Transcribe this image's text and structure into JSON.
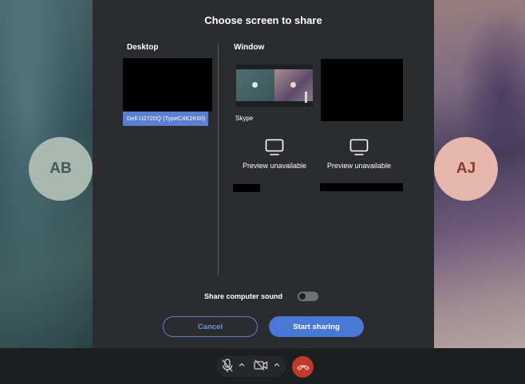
{
  "participants": [
    {
      "initials": "AB",
      "color": "#a9b8b1"
    },
    {
      "initials": "AJ",
      "color": "#e7b6ad"
    }
  ],
  "dialog": {
    "title": "Choose screen to share",
    "desktop": {
      "label": "Desktop",
      "screens": [
        {
          "name": "Dell U2720Q (TypeC4K2K60)",
          "selected": true
        }
      ]
    },
    "window": {
      "label": "Window",
      "items": [
        {
          "name": "Skype"
        },
        {
          "name": ""
        },
        {
          "preview_text": "Preview unavailable"
        },
        {
          "preview_text": "Preview unavailable"
        }
      ]
    },
    "share_sound": {
      "label": "Share computer sound",
      "enabled": false
    },
    "cancel_label": "Cancel",
    "start_label": "Start sharing"
  },
  "toolbar": {
    "icons": [
      "microphone-muted-icon",
      "chevron-up-icon",
      "camera-off-icon",
      "chevron-up-icon",
      "hang-up-icon"
    ],
    "hangup_color": "#c0392b"
  },
  "colors": {
    "accent": "#4a78d6",
    "dialog_bg": "#2b2c2f"
  }
}
